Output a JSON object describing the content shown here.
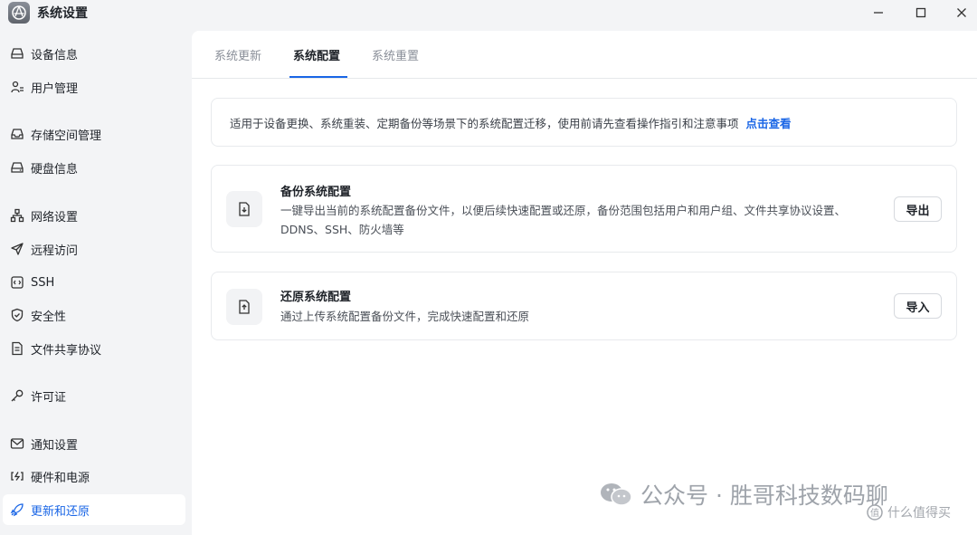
{
  "window": {
    "title": "系统设置",
    "icons": {
      "app": "aperture-icon",
      "minimize": "minimize-icon",
      "maximize": "maximize-icon",
      "close": "close-icon"
    }
  },
  "sidebar": {
    "items": [
      {
        "label": "设备信息",
        "icon": "device-icon"
      },
      {
        "label": "用户管理",
        "icon": "user-icon"
      },
      {
        "label": "存储空间管理",
        "icon": "storage-icon"
      },
      {
        "label": "硬盘信息",
        "icon": "disk-icon"
      },
      {
        "label": "网络设置",
        "icon": "network-icon"
      },
      {
        "label": "远程访问",
        "icon": "send-icon"
      },
      {
        "label": "SSH",
        "icon": "terminal-icon"
      },
      {
        "label": "安全性",
        "icon": "shield-icon"
      },
      {
        "label": "文件共享协议",
        "icon": "file-icon"
      },
      {
        "label": "许可证",
        "icon": "key-icon"
      },
      {
        "label": "通知设置",
        "icon": "mail-icon"
      },
      {
        "label": "硬件和电源",
        "icon": "power-icon"
      },
      {
        "label": "更新和还原",
        "icon": "rocket-icon",
        "active": true
      }
    ]
  },
  "tabs": [
    {
      "label": "系统更新"
    },
    {
      "label": "系统配置",
      "active": true
    },
    {
      "label": "系统重置"
    }
  ],
  "notice": {
    "text": "适用于设备更换、系统重装、定期备份等场景下的系统配置迁移，使用前请先查看操作指引和注意事项",
    "link": "点击查看"
  },
  "cards": {
    "backup": {
      "title": "备份系统配置",
      "desc": "一键导出当前的系统配置备份文件，以便后续快速配置或还原，备份范围包括用户和用户组、文件共享协议设置、DDNS、SSH、防火墙等",
      "button": "导出",
      "icon": "download-icon"
    },
    "restore": {
      "title": "还原系统配置",
      "desc": "通过上传系统配置备份文件，完成快速配置和还原",
      "button": "导入",
      "icon": "upload-icon"
    }
  },
  "watermark": {
    "text": "公众号 · 胜哥科技数码聊",
    "site": "什么值得买"
  },
  "colors": {
    "accent": "#1a66e6",
    "background": "#f3f4f6",
    "panel": "#ffffff"
  }
}
